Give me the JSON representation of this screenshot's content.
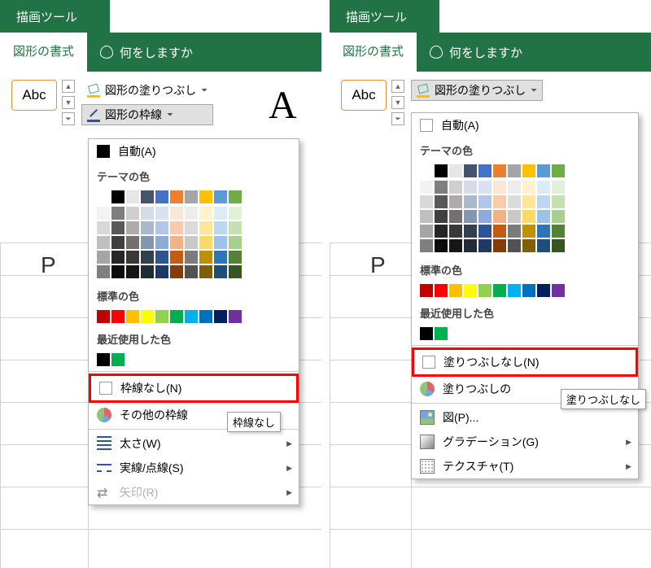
{
  "common": {
    "tool_tab": "描画ツール",
    "format_tab": "図形の書式",
    "tell_me": "何をしますか",
    "abc": "Abc",
    "fill_dropdown": "図形の塗りつぶし",
    "outline_dropdown": "図形の枠線",
    "auto": "自動(A)",
    "section_theme": "テーマの色",
    "section_standard": "標準の色",
    "section_recent": "最近使用した色",
    "col_P": "P",
    "big_A": "A",
    "theme_colors_row": [
      "#ffffff",
      "#000000",
      "#e7e6e6",
      "#44546a",
      "#4472c4",
      "#ed7d31",
      "#a5a5a5",
      "#ffc000",
      "#5b9bd5",
      "#70ad47"
    ],
    "theme_colors_grid": [
      "#f2f2f2",
      "#7f7f7f",
      "#d0cece",
      "#d6dce4",
      "#d9e2f3",
      "#fbe5d5",
      "#ededed",
      "#fff2cc",
      "#deebf6",
      "#e2efd9",
      "#d8d8d8",
      "#595959",
      "#aeabab",
      "#adb9ca",
      "#b4c6e7",
      "#f7cbac",
      "#dbdbdb",
      "#fee599",
      "#bdd7ee",
      "#c5e0b3",
      "#bfbfbf",
      "#3f3f3f",
      "#757070",
      "#8496b0",
      "#8eaadb",
      "#f4b183",
      "#c9c9c9",
      "#ffd965",
      "#9cc3e5",
      "#a8d08d",
      "#a5a5a5",
      "#262626",
      "#3a3838",
      "#323f4f",
      "#2f5496",
      "#c55a11",
      "#7b7b7b",
      "#bf9000",
      "#2e75b5",
      "#538135",
      "#7f7f7f",
      "#0c0c0c",
      "#171616",
      "#222a35",
      "#1f3864",
      "#833c0b",
      "#525252",
      "#7f6000",
      "#1e4e79",
      "#375623"
    ],
    "standard_colors": [
      "#c00000",
      "#ff0000",
      "#ffc000",
      "#ffff00",
      "#92d050",
      "#00b050",
      "#00b0f0",
      "#0070c0",
      "#002060",
      "#7030a0"
    ]
  },
  "left": {
    "recent_colors": [
      "#000000",
      "#00b050"
    ],
    "item_none": "枠線なし(N)",
    "item_more": "その他の枠線",
    "tooltip_none": "枠線なし",
    "item_weight": "太さ(W)",
    "item_dash": "実線/点線(S)",
    "item_arrow": "矢印(R)"
  },
  "right": {
    "recent_colors": [
      "#000000",
      "#00b050"
    ],
    "item_none": "塗りつぶしなし(N)",
    "item_more": "塗りつぶしの",
    "tooltip_none": "塗りつぶしなし",
    "item_picture": "図(P)...",
    "item_gradient": "グラデーション(G)",
    "item_texture": "テクスチャ(T)"
  }
}
